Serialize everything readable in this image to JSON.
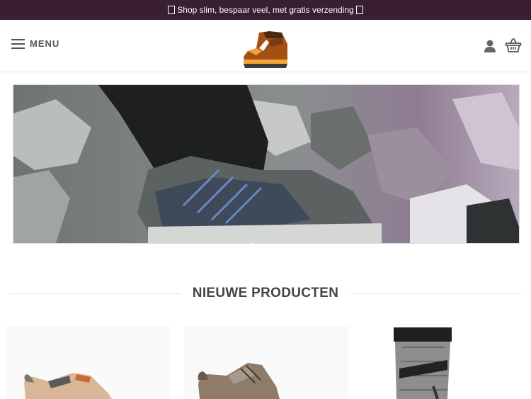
{
  "topbar": {
    "text": "Shop slim, bespaar veel, met gratis verzending"
  },
  "header": {
    "menu_label": "MENU"
  },
  "section": {
    "title": "NIEUWE PRODUCTEN"
  },
  "colors": {
    "topbar_bg": "#3a1e33",
    "text_gray": "#555555"
  },
  "icons": {
    "menu": "hamburger-icon",
    "user": "user-icon",
    "cart": "basket-icon"
  }
}
